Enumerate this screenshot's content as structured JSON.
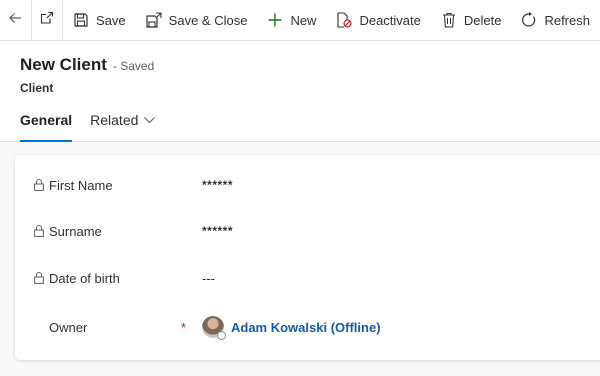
{
  "commandbar": {
    "back_icon": "back-arrow-icon",
    "popout_icon": "open-in-new-window-icon",
    "buttons": [
      {
        "label": "Save",
        "icon": "save-icon"
      },
      {
        "label": "Save & Close",
        "icon": "save-close-icon"
      },
      {
        "label": "New",
        "icon": "plus-icon"
      },
      {
        "label": "Deactivate",
        "icon": "deactivate-icon"
      },
      {
        "label": "Delete",
        "icon": "trash-icon"
      },
      {
        "label": "Refresh",
        "icon": "refresh-icon"
      }
    ]
  },
  "header": {
    "title": "New Client",
    "status": "- Saved",
    "entity": "Client"
  },
  "tabs": [
    {
      "label": "General",
      "active": true
    },
    {
      "label": "Related",
      "active": false
    }
  ],
  "form": {
    "fields": [
      {
        "label": "First Name",
        "value": "******",
        "locked": true
      },
      {
        "label": "Surname",
        "value": "******",
        "locked": true
      },
      {
        "label": "Date of birth",
        "value": "---",
        "locked": true
      },
      {
        "label": "Owner",
        "value": "Adam Kowalski (Offline)",
        "locked": false,
        "required": true,
        "required_mark": "*"
      }
    ]
  },
  "colors": {
    "accent": "#0078d4",
    "link": "#115ea3",
    "required": "#a4262c",
    "new_icon": "#107c10"
  }
}
